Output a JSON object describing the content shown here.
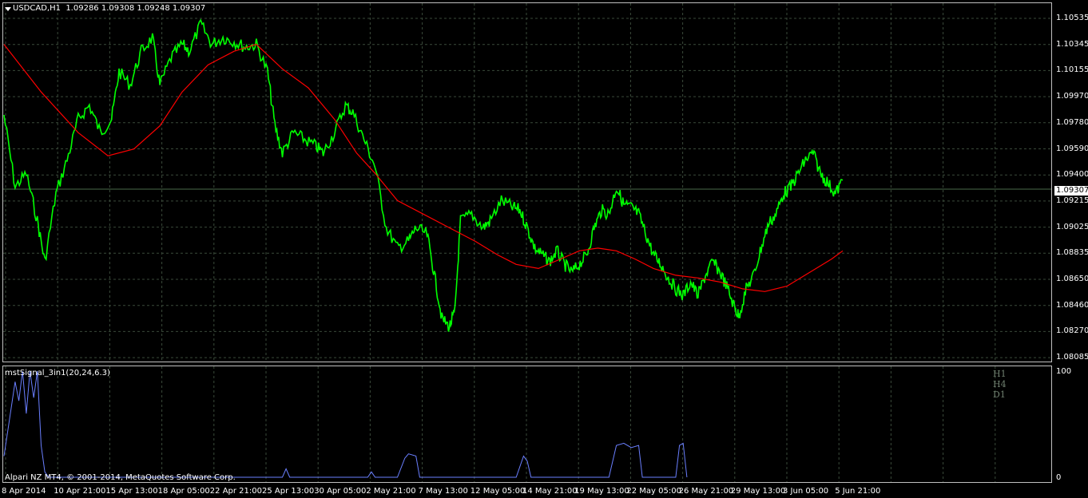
{
  "chart_header": {
    "symbol": "USDCAD,H1",
    "ohlc": "1.09286 1.09308 1.09248 1.09307"
  },
  "indicator": {
    "name": "mstSignal_3in1(20,24,6.3)",
    "scale_max": "100",
    "scale_min": "0",
    "timeframes": [
      "H1",
      "H4",
      "D1"
    ]
  },
  "broker_text": "Alpari NZ MT4, © 2001-2014, MetaQuotes Software Corp.",
  "current_price": "1.09307",
  "colors": {
    "background": "#000000",
    "price": "#00ff00",
    "moving_average": "#ff0000",
    "indicator": "#6a7fff",
    "grid": "#3a4a3a"
  },
  "chart_data": {
    "type": "line",
    "y_ticks": [
      "1.10535",
      "1.10345",
      "1.10155",
      "1.09970",
      "1.09780",
      "1.09590",
      "1.09400",
      "1.09215",
      "1.09025",
      "1.08835",
      "1.08650",
      "1.08460",
      "1.08270",
      "1.08085"
    ],
    "x_ticks": [
      "8 Apr 2014",
      "10 Apr 21:00",
      "15 Apr 13:00",
      "18 Apr 05:00",
      "22 Apr 21:00",
      "25 Apr 13:00",
      "30 Apr 05:00",
      "2 May 21:00",
      "7 May 13:00",
      "12 May 05:00",
      "14 May 21:00",
      "19 May 13:00",
      "22 May 05:00",
      "26 May 21:00",
      "29 May 13:00",
      "3 Jun 05:00",
      "5 Jun 21:00"
    ],
    "ylim": [
      1.08,
      1.1058
    ],
    "price_series": [
      [
        0,
        1.0978
      ],
      [
        6,
        1.0925
      ],
      [
        12,
        1.0935
      ],
      [
        18,
        1.09
      ],
      [
        22,
        1.087
      ],
      [
        28,
        1.092
      ],
      [
        34,
        1.0945
      ],
      [
        40,
        1.0975
      ],
      [
        46,
        1.0985
      ],
      [
        52,
        1.0965
      ],
      [
        58,
        1.0975
      ],
      [
        62,
        1.101
      ],
      [
        68,
        1.1
      ],
      [
        74,
        1.1025
      ],
      [
        80,
        1.1035
      ],
      [
        84,
        1.1
      ],
      [
        90,
        1.102
      ],
      [
        96,
        1.103
      ],
      [
        100,
        1.1025
      ],
      [
        106,
        1.1045
      ],
      [
        112,
        1.103
      ],
      [
        118,
        1.1035
      ],
      [
        124,
        1.1032
      ],
      [
        130,
        1.1028
      ],
      [
        136,
        1.103
      ],
      [
        142,
        1.101
      ],
      [
        146,
        1.097
      ],
      [
        150,
        1.095
      ],
      [
        156,
        1.0965
      ],
      [
        162,
        1.096
      ],
      [
        168,
        1.0955
      ],
      [
        172,
        1.095
      ],
      [
        178,
        1.0965
      ],
      [
        184,
        1.0985
      ],
      [
        188,
        1.098
      ],
      [
        194,
        1.096
      ],
      [
        200,
        1.094
      ],
      [
        206,
        1.0895
      ],
      [
        212,
        1.088
      ],
      [
        218,
        1.0885
      ],
      [
        222,
        1.0895
      ],
      [
        228,
        1.089
      ],
      [
        232,
        1.086
      ],
      [
        236,
        1.0828
      ],
      [
        240,
        1.0822
      ],
      [
        243,
        1.0833
      ],
      [
        246,
        1.09
      ],
      [
        252,
        1.0905
      ],
      [
        258,
        1.0895
      ],
      [
        262,
        1.09
      ],
      [
        268,
        1.0915
      ],
      [
        274,
        1.091
      ],
      [
        278,
        1.0908
      ],
      [
        282,
        1.0895
      ],
      [
        286,
        1.088
      ],
      [
        290,
        1.0875
      ],
      [
        294,
        1.087
      ],
      [
        298,
        1.0878
      ],
      [
        302,
        1.0868
      ],
      [
        306,
        1.0862
      ],
      [
        310,
        1.0868
      ],
      [
        314,
        1.0875
      ],
      [
        318,
        1.0895
      ],
      [
        322,
        1.0908
      ],
      [
        326,
        1.0905
      ],
      [
        330,
        1.0925
      ],
      [
        334,
        1.0912
      ],
      [
        338,
        1.091
      ],
      [
        342,
        1.0905
      ],
      [
        346,
        1.089
      ],
      [
        350,
        1.0875
      ],
      [
        354,
        1.0868
      ],
      [
        358,
        1.0858
      ],
      [
        362,
        1.085
      ],
      [
        366,
        1.0845
      ],
      [
        370,
        1.0855
      ],
      [
        374,
        1.0845
      ],
      [
        378,
        1.086
      ],
      [
        382,
        1.087
      ],
      [
        386,
        1.0862
      ],
      [
        390,
        1.085
      ],
      [
        394,
        1.0835
      ],
      [
        396,
        1.083
      ],
      [
        400,
        1.085
      ],
      [
        404,
        1.086
      ],
      [
        408,
        1.088
      ],
      [
        412,
        1.0898
      ],
      [
        416,
        1.0905
      ],
      [
        420,
        1.092
      ],
      [
        424,
        1.0925
      ],
      [
        428,
        1.0935
      ],
      [
        432,
        1.0945
      ],
      [
        436,
        1.095
      ],
      [
        440,
        1.0935
      ],
      [
        444,
        1.0928
      ],
      [
        448,
        1.092
      ],
      [
        452,
        1.093
      ]
    ],
    "ma_series": [
      [
        0,
        1.103
      ],
      [
        20,
        1.0995
      ],
      [
        40,
        1.0965
      ],
      [
        56,
        1.0948
      ],
      [
        70,
        1.0953
      ],
      [
        84,
        1.097
      ],
      [
        96,
        1.0995
      ],
      [
        110,
        1.1015
      ],
      [
        124,
        1.1025
      ],
      [
        136,
        1.103
      ],
      [
        150,
        1.1012
      ],
      [
        164,
        1.0998
      ],
      [
        178,
        1.0975
      ],
      [
        190,
        1.095
      ],
      [
        200,
        1.0935
      ],
      [
        212,
        1.0915
      ],
      [
        226,
        1.0905
      ],
      [
        240,
        1.0895
      ],
      [
        254,
        1.0885
      ],
      [
        266,
        1.0875
      ],
      [
        276,
        1.0868
      ],
      [
        288,
        1.0865
      ],
      [
        300,
        1.0872
      ],
      [
        310,
        1.0878
      ],
      [
        320,
        1.088
      ],
      [
        330,
        1.0878
      ],
      [
        340,
        1.0872
      ],
      [
        350,
        1.0865
      ],
      [
        362,
        1.086
      ],
      [
        374,
        1.0858
      ],
      [
        386,
        1.0855
      ],
      [
        398,
        1.085
      ],
      [
        410,
        1.0848
      ],
      [
        422,
        1.0852
      ],
      [
        434,
        1.0862
      ],
      [
        446,
        1.0872
      ],
      [
        452,
        1.0878
      ]
    ],
    "indicator_series": [
      [
        0,
        20
      ],
      [
        3,
        55
      ],
      [
        6,
        90
      ],
      [
        8,
        72
      ],
      [
        10,
        100
      ],
      [
        12,
        60
      ],
      [
        14,
        100
      ],
      [
        16,
        75
      ],
      [
        18,
        100
      ],
      [
        20,
        30
      ],
      [
        22,
        5
      ],
      [
        24,
        0
      ],
      [
        150,
        0
      ],
      [
        152,
        8
      ],
      [
        154,
        0
      ],
      [
        196,
        0
      ],
      [
        198,
        5
      ],
      [
        200,
        0
      ],
      [
        212,
        0
      ],
      [
        216,
        18
      ],
      [
        218,
        22
      ],
      [
        222,
        20
      ],
      [
        224,
        0
      ],
      [
        276,
        0
      ],
      [
        280,
        20
      ],
      [
        282,
        15
      ],
      [
        284,
        0
      ],
      [
        326,
        0
      ],
      [
        330,
        30
      ],
      [
        334,
        32
      ],
      [
        338,
        28
      ],
      [
        342,
        30
      ],
      [
        344,
        0
      ],
      [
        362,
        0
      ],
      [
        364,
        30
      ],
      [
        366,
        32
      ],
      [
        368,
        0
      ]
    ]
  }
}
